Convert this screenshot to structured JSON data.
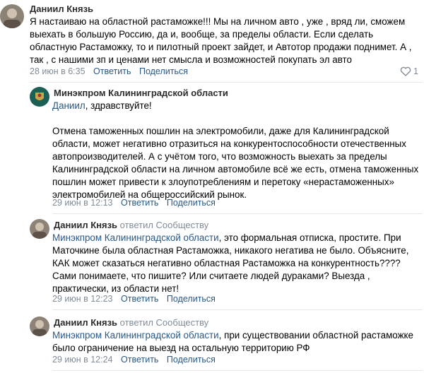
{
  "comments": [
    {
      "author": "Даниил Князь",
      "text": "Я настаиваю на областной растаможке!!! Мы на личном авто , уже , вряд ли, сможем выехать в большую Россию, да и, вообще, за пределы области. Если сделать областную Растаможку, то и пилотный проект зайдет, и Автотор продажи поднимет. А , так , с нашими зп и ценами нет смысла и возможностей покупать эл авто",
      "date": "28 июн в 6:35",
      "reply_label": "Ответить",
      "share_label": "Поделиться",
      "likes": "1"
    },
    {
      "author": "Минэкпром Калининградской области",
      "mention": "Даниил",
      "greeting": ", здравствуйте!",
      "text": "Отмена таможенных пошлин на электромобили, даже для Калининградской области, может негативно отразиться на конкурентоспособности отечественных автопроизводителей. А с учётом того, что возможность выехать за пределы Калининградской области на личном автомобиле всё же есть, отмена таможенных пошлин может привести к злоупотреблениям и перетоку «нерастаможенных» электромобилей на общероссийский рынок.",
      "date": "29 июн в 12:13",
      "reply_label": "Ответить",
      "share_label": "Поделиться"
    },
    {
      "author": "Даниил Князь",
      "replied": "ответил Сообществу",
      "mention": "Минэкпром Калининградской области",
      "text": ", это формальная отписка, простите. При Маточкине была областная Растаможка, никакого негатива не было. Объясните, КАК может сказаться негативно областная Растаможка на конкурентность???? Сами понимаете, что пишите? Или считаете людей дураками? Выезда , практически, из области нет!",
      "date": "29 июн в 12:23",
      "reply_label": "Ответить",
      "share_label": "Поделиться"
    },
    {
      "author": "Даниил Князь",
      "replied": "ответил Сообществу",
      "mention": "Минэкпром Калининградской области",
      "text": ", при существовании областной растаможке было ограничение на выезд на остальную территорию РФ",
      "date": "29 июн в 12:24",
      "reply_label": "Ответить",
      "share_label": "Поделиться"
    }
  ],
  "colors": {
    "link": "#2a5885",
    "meta": "#818c99",
    "author": "#2c2d2e"
  }
}
